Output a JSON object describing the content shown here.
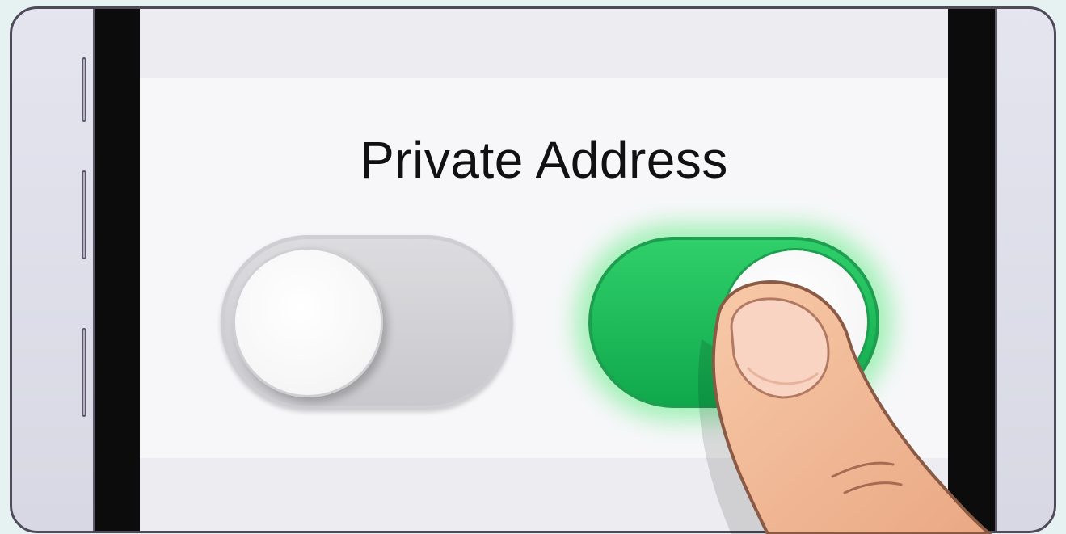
{
  "screen": {
    "title": "Private Address"
  },
  "toggles": [
    {
      "state": "off"
    },
    {
      "state": "on",
      "accent": "#1fbf5c"
    }
  ],
  "icons": {
    "finger": "pointing-finger-icon"
  }
}
